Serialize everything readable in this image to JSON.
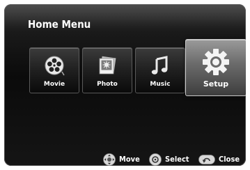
{
  "menu": {
    "title": "Home Menu",
    "items": [
      {
        "label": "Movie",
        "icon": "film-reel-icon"
      },
      {
        "label": "Photo",
        "icon": "photo-icon"
      },
      {
        "label": "Music",
        "icon": "music-note-icon"
      },
      {
        "label": "Setup",
        "icon": "gear-icon",
        "selected": true
      }
    ]
  },
  "hints": {
    "move": "Move",
    "select": "Select",
    "close": "Close"
  }
}
